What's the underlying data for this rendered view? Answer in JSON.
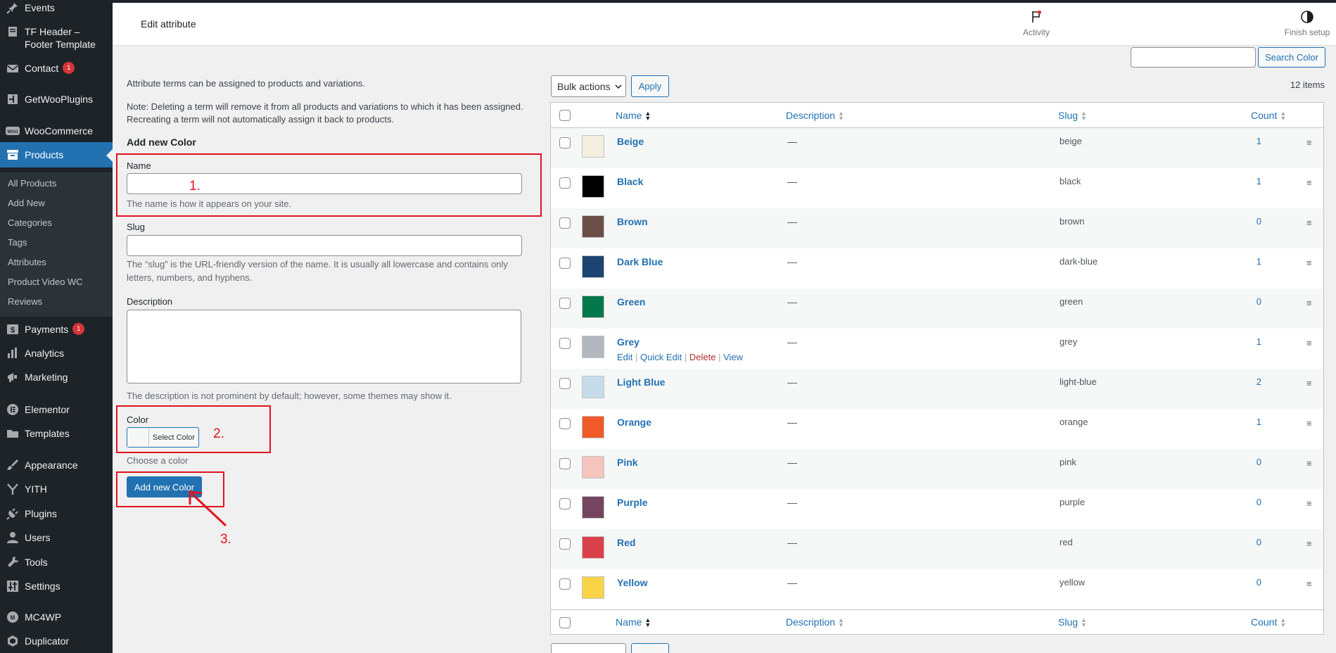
{
  "sidebar": {
    "items": [
      {
        "label": "Events",
        "icon": "pin-icon"
      },
      {
        "label": "TF Header –",
        "label2": "Footer Template",
        "icon": "page-icon"
      },
      {
        "label": "Contact",
        "icon": "mail-icon",
        "badge": "1"
      },
      {
        "label": "GetWooPlugins",
        "icon": "grid-icon"
      },
      {
        "label": "WooCommerce",
        "icon": "woo-icon"
      },
      {
        "label": "Products",
        "icon": "archive-icon",
        "active": true
      },
      {
        "label": "Payments",
        "icon": "dollar-icon",
        "badge": "1"
      },
      {
        "label": "Analytics",
        "icon": "bar-chart-icon"
      },
      {
        "label": "Marketing",
        "icon": "megaphone-icon"
      },
      {
        "label": "Elementor",
        "icon": "elementor-icon"
      },
      {
        "label": "Templates",
        "icon": "folder-icon"
      },
      {
        "label": "Appearance",
        "icon": "paintbrush-icon"
      },
      {
        "label": "YITH",
        "icon": "yith-icon"
      },
      {
        "label": "Plugins",
        "icon": "plug-icon"
      },
      {
        "label": "Users",
        "icon": "user-icon"
      },
      {
        "label": "Tools",
        "icon": "wrench-icon"
      },
      {
        "label": "Settings",
        "icon": "sliders-icon"
      },
      {
        "label": "MC4WP",
        "icon": "mc4wp-icon"
      },
      {
        "label": "Duplicator",
        "icon": "duplicator-icon"
      }
    ],
    "submenu": [
      "All Products",
      "Add New",
      "Categories",
      "Tags",
      "Attributes",
      "Product Video WC",
      "Reviews"
    ]
  },
  "header": {
    "title": "Edit attribute",
    "activity_label": "Activity",
    "finish_setup_label": "Finish setup"
  },
  "search": {
    "button_label": "Search Color",
    "value": ""
  },
  "bulk": {
    "select_label": "Bulk actions",
    "apply_label": "Apply",
    "items_count": "12 items"
  },
  "form": {
    "intro": "Attribute terms can be assigned to products and variations.",
    "note_line1": "Note: Deleting a term will remove it from all products and variations to which it has been assigned.",
    "note_line2": "Recreating a term will not automatically assign it back to products.",
    "heading": "Add new Color",
    "name_label": "Name",
    "name_value": "",
    "name_help": "The name is how it appears on your site.",
    "slug_label": "Slug",
    "slug_value": "",
    "slug_help_line1": "The “slug” is the URL-friendly version of the name. It is usually all lowercase and contains only",
    "slug_help_line2": "letters, numbers, and hyphens.",
    "description_label": "Description",
    "description_value": "",
    "description_help": "The description is not prominent by default; however, some themes may show it.",
    "color_label": "Color",
    "select_color_label": "Select Color",
    "color_help": "Choose a color",
    "submit_label": "Add new Color"
  },
  "annotations": {
    "one": "1.",
    "two": "2.",
    "three": "3."
  },
  "table": {
    "columns": {
      "name": "Name",
      "description": "Description",
      "slug": "Slug",
      "count": "Count"
    },
    "rows": [
      {
        "name": "Beige",
        "description": "—",
        "slug": "beige",
        "count": "1",
        "color": "#f5efe0"
      },
      {
        "name": "Black",
        "description": "—",
        "slug": "black",
        "count": "1",
        "color": "#000000"
      },
      {
        "name": "Brown",
        "description": "—",
        "slug": "brown",
        "count": "0",
        "color": "#6b4f47"
      },
      {
        "name": "Dark Blue",
        "description": "—",
        "slug": "dark-blue",
        "count": "1",
        "color": "#1d4370"
      },
      {
        "name": "Green",
        "description": "—",
        "slug": "green",
        "count": "0",
        "color": "#04784a"
      },
      {
        "name": "Grey",
        "description": "—",
        "slug": "grey",
        "count": "1",
        "color": "#b3b7be",
        "actions": {
          "edit": "Edit",
          "quick_edit": "Quick Edit",
          "delete": "Delete",
          "view": "View"
        }
      },
      {
        "name": "Light Blue",
        "description": "—",
        "slug": "light-blue",
        "count": "2",
        "color": "#c6dcea"
      },
      {
        "name": "Orange",
        "description": "—",
        "slug": "orange",
        "count": "1",
        "color": "#f05a29"
      },
      {
        "name": "Pink",
        "description": "—",
        "slug": "pink",
        "count": "0",
        "color": "#f4c4bd"
      },
      {
        "name": "Purple",
        "description": "—",
        "slug": "purple",
        "count": "0",
        "color": "#75445f"
      },
      {
        "name": "Red",
        "description": "—",
        "slug": "red",
        "count": "0",
        "color": "#d9404a"
      },
      {
        "name": "Yellow",
        "description": "—",
        "slug": "yellow",
        "count": "0",
        "color": "#f9d447"
      }
    ]
  },
  "colors": {
    "accent": "#2271b1",
    "sidebar_bg": "#1d2327",
    "annotation": "#e0141e",
    "delete": "#b32d2e"
  }
}
